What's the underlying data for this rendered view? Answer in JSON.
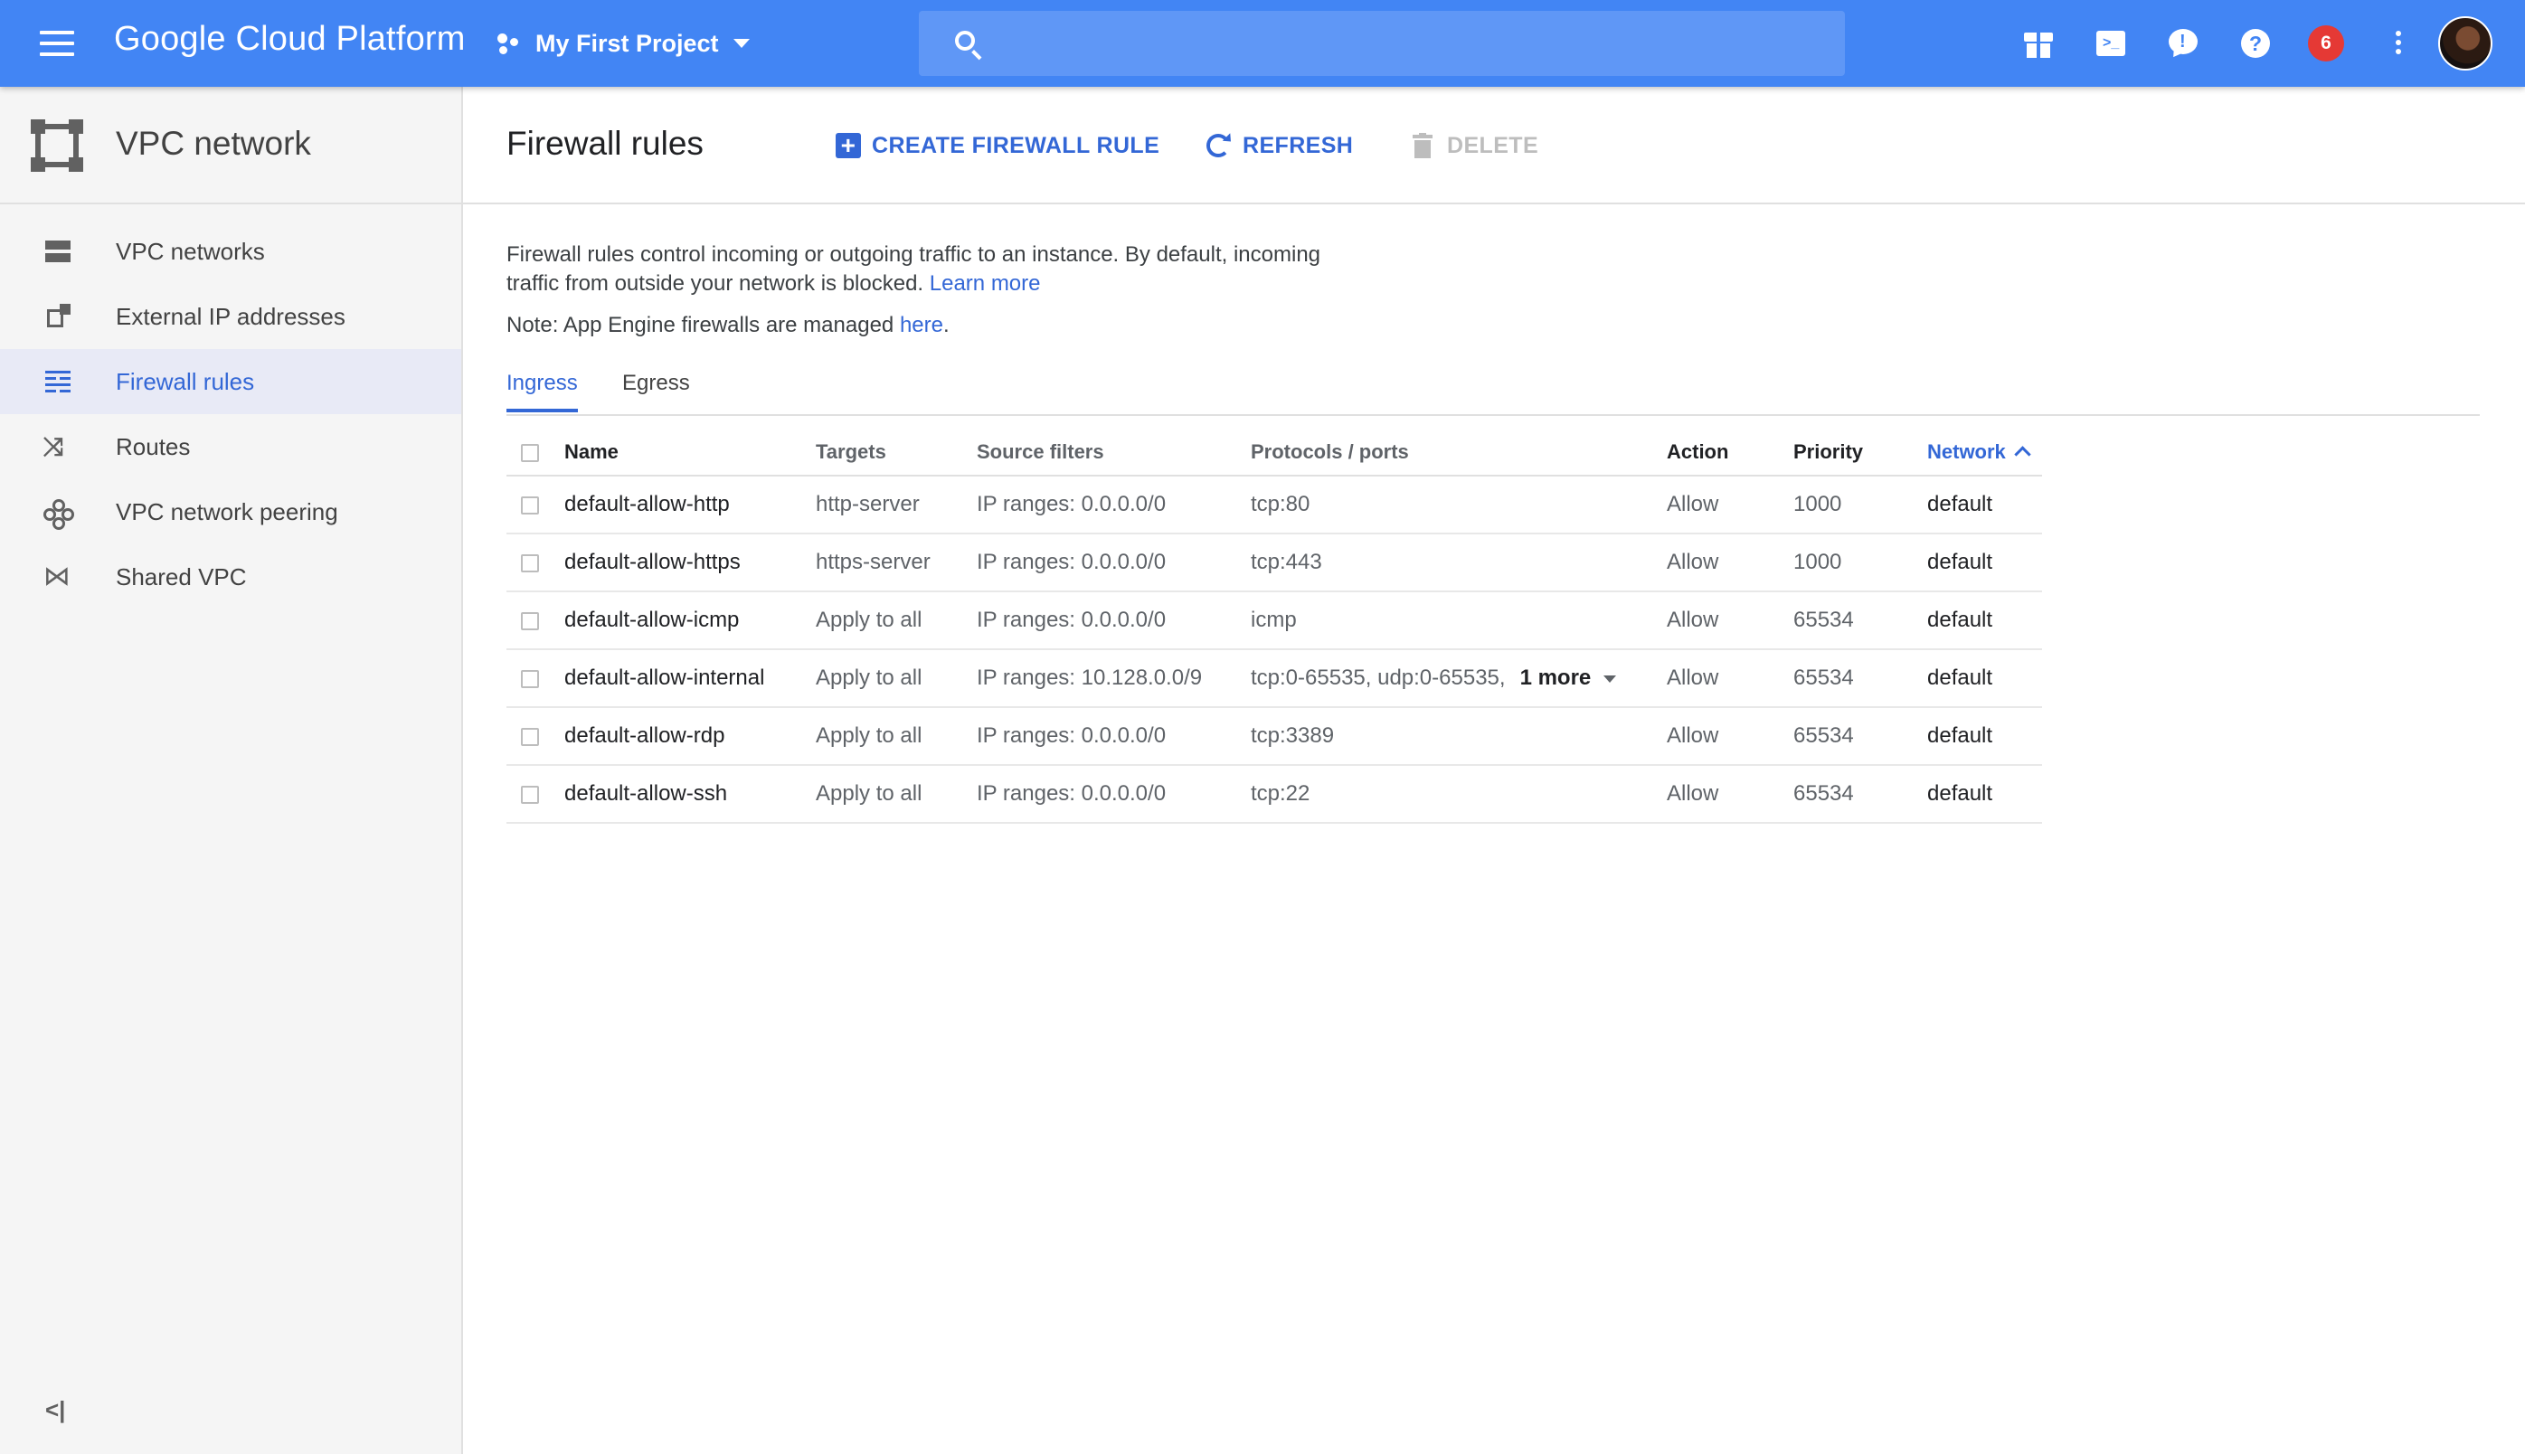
{
  "topbar": {
    "brand": "Google Cloud Platform",
    "project": "My First Project",
    "search_placeholder": "",
    "notifications_count": "6",
    "colors": {
      "bar": "#4285f4",
      "badge": "#e53935"
    }
  },
  "sidebar": {
    "title": "VPC network",
    "items": [
      {
        "label": "VPC networks",
        "icon": "vpc-networks-icon"
      },
      {
        "label": "External IP addresses",
        "icon": "external-ip-icon"
      },
      {
        "label": "Firewall rules",
        "icon": "firewall-icon",
        "active": true
      },
      {
        "label": "Routes",
        "icon": "routes-icon"
      },
      {
        "label": "VPC network peering",
        "icon": "peering-icon"
      },
      {
        "label": "Shared VPC",
        "icon": "shared-vpc-icon"
      }
    ],
    "collapse_label": "<|"
  },
  "main": {
    "title": "Firewall rules",
    "actions": {
      "create": "CREATE FIREWALL RULE",
      "refresh": "REFRESH",
      "delete": "DELETE"
    },
    "description": "Firewall rules control incoming or outgoing traffic to an instance. By default, incoming traffic from outside your network is blocked.",
    "learn_more": "Learn more",
    "note_prefix": "Note: App Engine firewalls are managed ",
    "note_link": "here",
    "note_suffix": ".",
    "tabs": [
      {
        "label": "Ingress",
        "selected": true
      },
      {
        "label": "Egress",
        "selected": false
      }
    ]
  },
  "table": {
    "columns": [
      "Name",
      "Targets",
      "Source filters",
      "Protocols / ports",
      "Action",
      "Priority",
      "Network"
    ],
    "sorted_column": "Network",
    "rows": [
      {
        "name": "default-allow-http",
        "targets": "http-server",
        "source": "IP ranges: 0.0.0.0/0",
        "protocols": "tcp:80",
        "more": "",
        "action": "Allow",
        "priority": "1000",
        "network": "default"
      },
      {
        "name": "default-allow-https",
        "targets": "https-server",
        "source": "IP ranges: 0.0.0.0/0",
        "protocols": "tcp:443",
        "more": "",
        "action": "Allow",
        "priority": "1000",
        "network": "default"
      },
      {
        "name": "default-allow-icmp",
        "targets": "Apply to all",
        "source": "IP ranges: 0.0.0.0/0",
        "protocols": "icmp",
        "more": "",
        "action": "Allow",
        "priority": "65534",
        "network": "default"
      },
      {
        "name": "default-allow-internal",
        "targets": "Apply to all",
        "source": "IP ranges: 10.128.0.0/9",
        "protocols": "tcp:0-65535, udp:0-65535,",
        "more": "1 more",
        "action": "Allow",
        "priority": "65534",
        "network": "default"
      },
      {
        "name": "default-allow-rdp",
        "targets": "Apply to all",
        "source": "IP ranges: 0.0.0.0/0",
        "protocols": "tcp:3389",
        "more": "",
        "action": "Allow",
        "priority": "65534",
        "network": "default"
      },
      {
        "name": "default-allow-ssh",
        "targets": "Apply to all",
        "source": "IP ranges: 0.0.0.0/0",
        "protocols": "tcp:22",
        "more": "",
        "action": "Allow",
        "priority": "65534",
        "network": "default"
      }
    ]
  }
}
